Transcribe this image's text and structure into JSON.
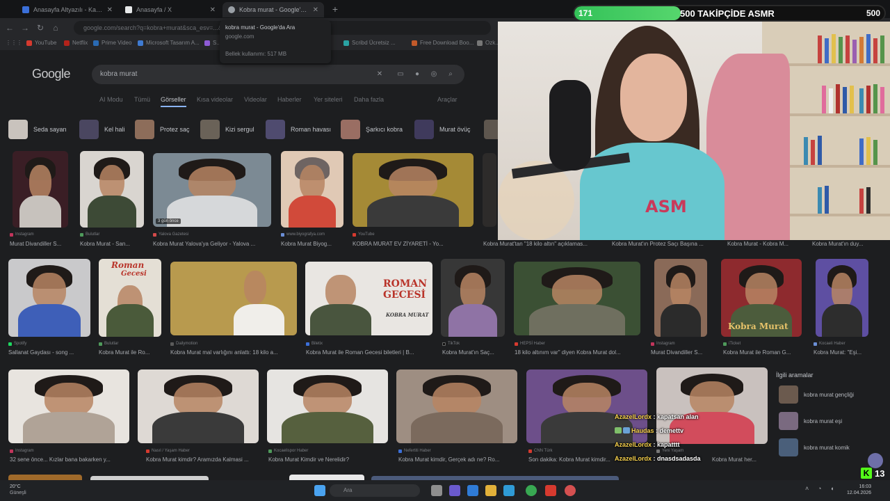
{
  "browser": {
    "tabs": [
      {
        "title": "Anasayfa Altyazılı - Kafası Güzel",
        "active": false
      },
      {
        "title": "Anasayfa / X",
        "active": false
      },
      {
        "title": "Kobra murat - Google'da Ara",
        "active": true
      }
    ],
    "tab_hover": {
      "title": "kobra murat - Google'da Ara",
      "domain": "google.com",
      "memory": "Bellek kullanımı: 517 MB"
    },
    "url": "google.com/search?q=kobra+murat&sca_esv=...&udm=2",
    "bookmarks": [
      "YouTube",
      "Netflix",
      "Prime Video",
      "Microsoft Tasarım A...",
      "S...",
      "Scribd Ücretsiz ...",
      "Free Download Boo...",
      "Ozk..."
    ]
  },
  "google": {
    "logo": "Google",
    "query": "kobra murat",
    "filters": [
      "AI Modu",
      "Tümü",
      "Görseller",
      "Kısa videolar",
      "Videolar",
      "Haberler",
      "Yer siteleri",
      "Daha fazla",
      "Araçlar"
    ],
    "active_filter": "Görseller",
    "chips": [
      "Seda sayan",
      "Kel hali",
      "Protez saç",
      "Kizi sergul",
      "Roman havası",
      "Şarkıcı kobra",
      "Murat övüç"
    ],
    "row1": [
      {
        "source": "Instagram",
        "caption": "Murat Divandiller S..."
      },
      {
        "source": "Bulutlar",
        "caption": "Kobra Murat - San..."
      },
      {
        "source": "Yalova Gazetesi",
        "caption": "Kobra Murat Yalova'ya Geliyor - Yalova ...",
        "badge": "3 gün önce"
      },
      {
        "source": "www.biyografya.com",
        "caption": "Kobra Murat Biyog..."
      },
      {
        "source": "YouTube",
        "caption": "KOBRA MURAT EV ZİYARETİ - Yo..."
      },
      {
        "source": "",
        "caption": "Kobra Murat'tan \"18 kilo altın\" açıklamas..."
      },
      {
        "source": "",
        "caption": "Kobra Murat'ın Protez Saçı Başına ..."
      },
      {
        "source": "",
        "caption": "Kobra Murat - Kobra M..."
      },
      {
        "source": "",
        "caption": "Kobra Murat'ın duy..."
      }
    ],
    "row2": [
      {
        "source": "Spotify",
        "caption": "Sallanat Gaydası - song ..."
      },
      {
        "source": "Bulutlar",
        "caption": "Kobra Murat ile Ro..."
      },
      {
        "source": "Dailymotion",
        "caption": "Kobra Murat mal varlığını anlattı: 18 kilo a..."
      },
      {
        "source": "Biletix",
        "caption": "Kobra Murat ile Roman Gecesi biletleri | B..."
      },
      {
        "source": "TikTok",
        "caption": "Kobra Murat'ın Saç..."
      },
      {
        "source": "HEPSİ Haber",
        "caption": "18 kilo altınım var\" diyen Kobra Murat dol..."
      },
      {
        "source": "Instagram",
        "caption": "Murat Divandiller S..."
      },
      {
        "source": "iTicket",
        "caption": "Kobra Murat ile Roman G..."
      },
      {
        "source": "Kocaeli Haber",
        "caption": "Kobra Murat: \"Eşi..."
      }
    ],
    "row2_overlays": {
      "poster_top": "Roman",
      "poster_bottom": "Gecesi",
      "roman_gecesi": "ROMAN GECESİ",
      "roman_sub": "KOBRA MURAT",
      "kobra_murat": "Kobra Murat"
    },
    "row3": [
      {
        "source": "Instagram",
        "caption": "32 sene önce... Kızlar bana bakarken y..."
      },
      {
        "source": "Nasıl / Yaşam Haber",
        "caption": "Kobra Murat kimdir? Aramızda Kalmasi ..."
      },
      {
        "source": "Kocaelispor Haber",
        "caption": "Kobra Murat Kimdir ve Nerelidir?"
      },
      {
        "source": "Nefertiti Haber",
        "caption": "Kobra Murat kimdir, Gerçek adı ne? Ro..."
      },
      {
        "source": "CNN Türk",
        "caption": "Son dakika: Kobra Murat kimdir..."
      },
      {
        "source": "Yeni Yaşam",
        "caption": "Kobra Murat her..."
      }
    ],
    "related": {
      "title": "İlgili aramalar",
      "items": [
        "kobra murat gençliği",
        "kobra murat eşi",
        "kobra murat komik"
      ]
    }
  },
  "stream": {
    "goal": {
      "current": "171",
      "label": "500 TAKİPÇİDE ASMR",
      "target": "500",
      "progress": 0.342
    },
    "shirt_text": "ASM",
    "chat": [
      {
        "user": "AzazelLordx",
        "msg": "kapatsan alan"
      },
      {
        "user": "Haudas",
        "msg": "demettv"
      },
      {
        "user": "AzazelLordx",
        "msg": "kapatttt"
      },
      {
        "user": "AzazelLordx",
        "msg": "dnasdsadasda"
      }
    ],
    "viewers": "13",
    "kick_letter": "K"
  },
  "taskbar": {
    "temp": "20°C",
    "weather": "Güneşli",
    "search": "Ara",
    "time": "16:03",
    "date": "12.04.2026"
  }
}
